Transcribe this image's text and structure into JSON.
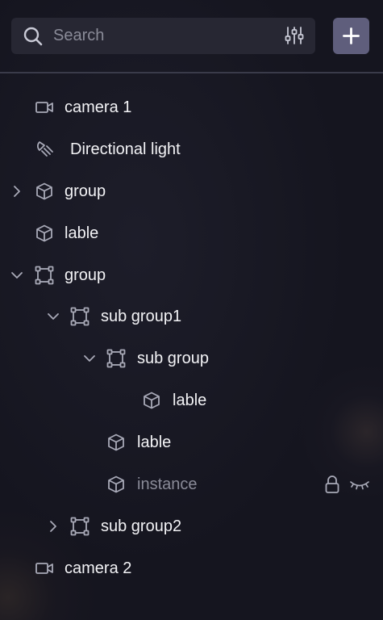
{
  "search": {
    "placeholder": "Search",
    "value": ""
  },
  "add_button": {
    "icon": "plus-icon"
  },
  "tree": [
    {
      "label": "camera 1",
      "icon": "camera-icon",
      "expand": "none"
    },
    {
      "label": "Directional light",
      "icon": "directional-light-icon",
      "expand": "none"
    },
    {
      "label": "group",
      "icon": "cube-icon",
      "expand": "collapsed"
    },
    {
      "label": "lable",
      "icon": "cube-icon",
      "expand": "none"
    },
    {
      "label": "group",
      "icon": "group-frame-icon",
      "expand": "expanded"
    },
    {
      "label": "sub group1",
      "icon": "group-frame-icon",
      "expand": "expanded"
    },
    {
      "label": "sub group",
      "icon": "group-frame-icon",
      "expand": "expanded"
    },
    {
      "label": "lable",
      "icon": "cube-icon",
      "expand": "none"
    },
    {
      "label": "lable",
      "icon": "cube-icon",
      "expand": "none"
    },
    {
      "label": "instance",
      "icon": "cube-icon",
      "expand": "none",
      "locked": true,
      "hidden": true
    },
    {
      "label": "sub group2",
      "icon": "group-frame-icon",
      "expand": "collapsed"
    },
    {
      "label": "camera 2",
      "icon": "camera-icon",
      "expand": "none"
    }
  ],
  "colors": {
    "background": "#15151f",
    "search_bg": "#272733",
    "accent_button": "#5f5e7c",
    "text": "#f3f3f6",
    "muted_text": "#8a8b98",
    "icon": "#a9aab8"
  }
}
